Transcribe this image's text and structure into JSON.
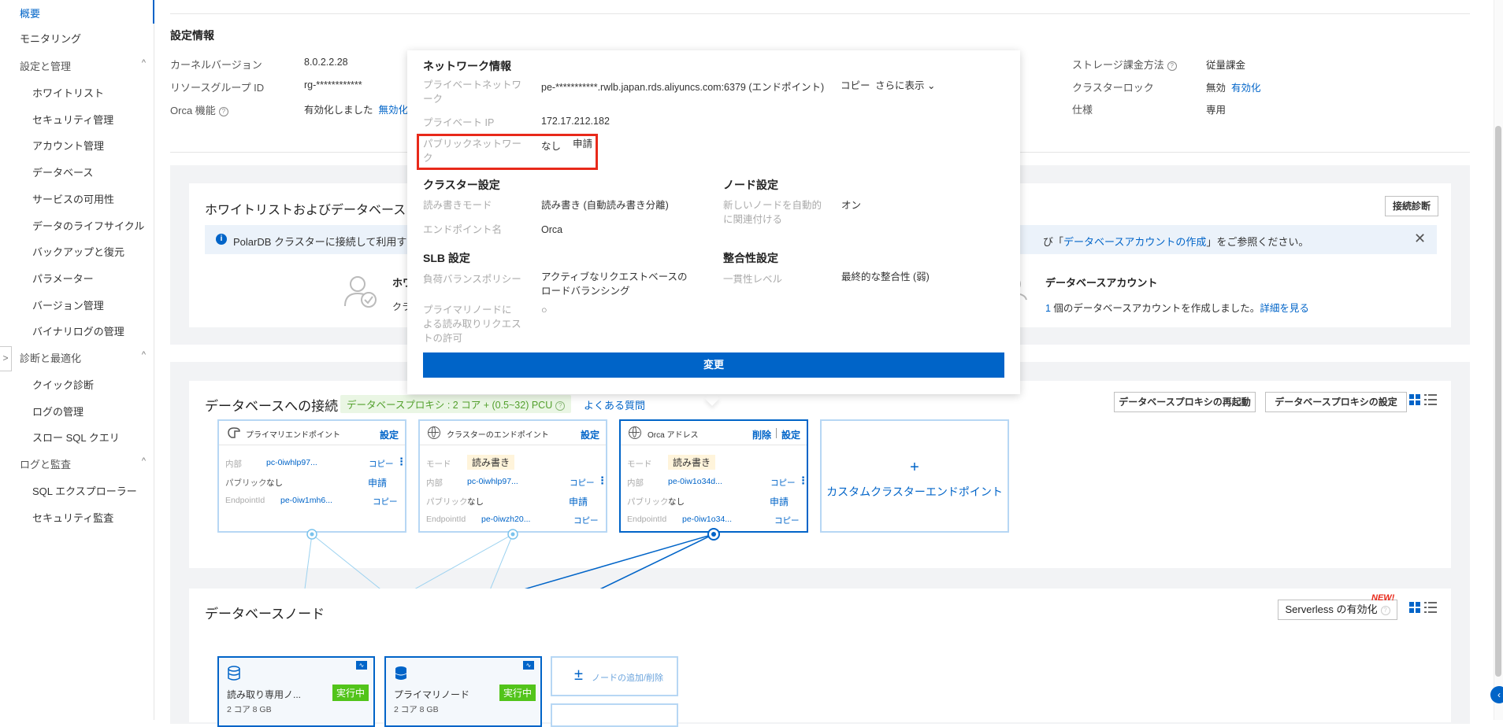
{
  "sidebar": {
    "active": "概要",
    "items": [
      {
        "label": "モニタリング"
      }
    ],
    "groups": [
      {
        "label": "設定と管理",
        "items": [
          "ホワイトリスト",
          "セキュリティ管理",
          "アカウント管理",
          "データベース",
          "サービスの可用性",
          "データのライフサイクル",
          "バックアップと復元",
          "パラメーター",
          "バージョン管理",
          "バイナリログの管理"
        ]
      },
      {
        "label": "診断と最適化",
        "items": [
          "クイック診断",
          "ログの管理",
          "スロー SQL クエリ"
        ]
      },
      {
        "label": "ログと監査",
        "items": [
          "SQL エクスプローラー",
          "セキュリティ監査"
        ]
      }
    ]
  },
  "settings": {
    "title": "設定情報",
    "kernel_label": "カーネルバージョン",
    "kernel_value": "8.0.2.2.28",
    "rg_label": "リソースグループ ID",
    "rg_value": "rg-************",
    "orca_label": "Orca 機能",
    "orca_value": "有効化しました",
    "orca_link": "無効化",
    "storage_label": "ストレージ課金方法",
    "storage_value": "従量課金",
    "lock_label": "クラスターロック",
    "lock_value": "無効",
    "lock_link": "有効化",
    "spec_label": "仕様",
    "spec_value": "専用"
  },
  "popover": {
    "network_title": "ネットワーク情報",
    "private_net_label": "プライベートネットワーク",
    "private_net_value": "pe-***********.rwlb.japan.rds.aliyuncs.com:6379 (エンドポイント)",
    "copy_link": "コピー",
    "more_link": "さらに表示",
    "private_ip_label": "プライベート IP",
    "private_ip_value": "172.17.212.182",
    "public_net_label": "パブリックネットワーク",
    "public_net_value": "なし",
    "apply_link": "申請",
    "cluster_title": "クラスター設定",
    "rw_mode_label": "読み書きモード",
    "rw_mode_value": "読み書き (自動読み書き分離)",
    "endpoint_name_label": "エンドポイント名",
    "endpoint_name_value": "Orca",
    "node_title": "ノード設定",
    "auto_assoc_label": "新しいノードを自動的に関連付ける",
    "auto_assoc_value": "オン",
    "slb_title": "SLB 設定",
    "lb_policy_label": "負荷バランスポリシー",
    "lb_policy_value": "アクティブなリクエストベースのロードバランシング",
    "primary_read_label": "プライマリノードによる読み取りリクエストの許可",
    "primary_read_value": "○",
    "consistency_title": "整合性設定",
    "consistency_label": "一貫性レベル",
    "consistency_value": "最終的な整合性 (弱)",
    "change_button": "変更"
  },
  "whitelist": {
    "title": "ホワイトリストおよびデータベース",
    "diagnose_button": "接続診断",
    "notice_start": "PolarDB クラスターに接続して利用する",
    "notice_mid": "び「",
    "notice_link": "データベースアカウントの作成",
    "notice_end": "」をご参照ください。",
    "left_title": "ホワ",
    "left_text": "クラ",
    "account_title": "データベースアカウント",
    "account_count": "1",
    "account_text": " 個のデータベースアカウントを作成しました。",
    "account_link": "詳細を見る"
  },
  "connection": {
    "title": "データベースへの接続",
    "proxy_badge": "データベースプロキシ : 2 コア + (0.5~32) PCU",
    "faq_link": "よくある質問",
    "restart_button": "データベースプロキシの再起動",
    "proxy_settings_button": "データベースプロキシの設定",
    "endpoints": [
      {
        "title": "プライマリエンドポイント",
        "action": "設定",
        "row1_label": "内部",
        "row1_value": "pc-0iwhlp97...",
        "row1_copy": "コピー",
        "row2_label": "パブリック",
        "row2_value": "なし",
        "row2_link": "申請",
        "row3_label": "EndpointId",
        "row3_value": "pe-0iw1mh6...",
        "row3_copy": "コピー"
      },
      {
        "title": "クラスターのエンドポイント",
        "action": "設定",
        "mode_label": "モード",
        "mode_value": "読み書き",
        "row1_label": "内部",
        "row1_value": "pc-0iwhlp97...",
        "row1_copy": "コピー",
        "row2_label": "パブリック",
        "row2_value": "なし",
        "row2_link": "申請",
        "row3_label": "EndpointId",
        "row3_value": "pe-0iwzh20...",
        "row3_copy": "コピー"
      },
      {
        "title": "Orca アドレス",
        "action_delete": "削除",
        "action": "設定",
        "mode_label": "モード",
        "mode_value": "読み書き",
        "row1_label": "内部",
        "row1_value": "pe-0iw1o34d...",
        "row1_copy": "コピー",
        "row2_label": "パブリック",
        "row2_value": "なし",
        "row2_link": "申請",
        "row3_label": "EndpointId",
        "row3_value": "pe-0iw1o34...",
        "row3_copy": "コピー"
      }
    ],
    "custom_endpoint": "カスタムクラスターエンドポイント"
  },
  "nodes": {
    "title": "データベースノード",
    "serverless_button": "Serverless の有効化",
    "new_badge": "NEW!",
    "items": [
      {
        "name": "読み取り専用ノ...",
        "status": "実行中",
        "spec": "2 コア 8 GB"
      },
      {
        "name": "プライマリノード",
        "status": "実行中",
        "spec": "2 コア 8 GB"
      }
    ],
    "add_remove": "ノードの追加/削除"
  },
  "colors": {
    "accent": "#0064c8",
    "running": "#52c41a",
    "highlight": "#e8291a"
  }
}
